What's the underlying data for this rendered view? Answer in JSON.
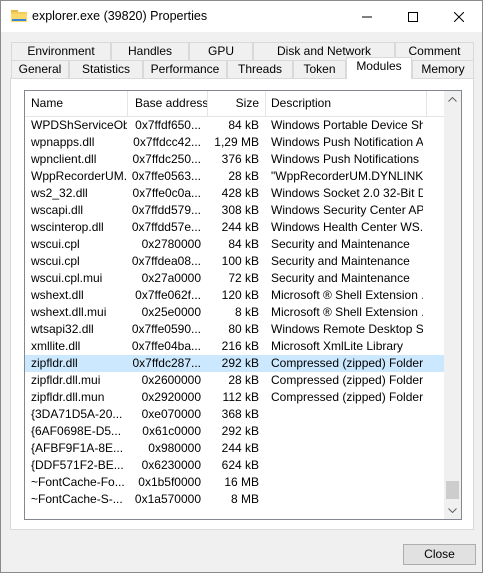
{
  "window": {
    "title": "explorer.exe (39820) Properties"
  },
  "tabs_back": [
    {
      "label": "Environment"
    },
    {
      "label": "Handles"
    },
    {
      "label": "GPU"
    },
    {
      "label": "Disk and Network"
    },
    {
      "label": "Comment"
    }
  ],
  "tabs_front": [
    {
      "label": "General"
    },
    {
      "label": "Statistics"
    },
    {
      "label": "Performance"
    },
    {
      "label": "Threads"
    },
    {
      "label": "Token"
    },
    {
      "label": "Modules"
    },
    {
      "label": "Memory"
    }
  ],
  "active_tab": "Modules",
  "columns": {
    "name": "Name",
    "base": "Base address",
    "size": "Size",
    "desc": "Description"
  },
  "rows": [
    {
      "name": "WPDShServiceObj.dll",
      "base": "0x7ffdf650...",
      "size": "84 kB",
      "desc": "Windows Portable Device Sh..."
    },
    {
      "name": "wpnapps.dll",
      "base": "0x7ffdcc42...",
      "size": "1,29 MB",
      "desc": "Windows Push Notification A..."
    },
    {
      "name": "wpnclient.dll",
      "base": "0x7ffdc250...",
      "size": "376 kB",
      "desc": "Windows Push Notifications ..."
    },
    {
      "name": "WppRecorderUM.dll",
      "base": "0x7ffe0563...",
      "size": "28 kB",
      "desc": "\"WppRecorderUM.DYNLINK\""
    },
    {
      "name": "ws2_32.dll",
      "base": "0x7ffe0c0a...",
      "size": "428 kB",
      "desc": "Windows Socket 2.0 32-Bit DLL"
    },
    {
      "name": "wscapi.dll",
      "base": "0x7ffdd579...",
      "size": "308 kB",
      "desc": "Windows Security Center API"
    },
    {
      "name": "wscinterop.dll",
      "base": "0x7ffdd57e...",
      "size": "244 kB",
      "desc": "Windows Health Center WS..."
    },
    {
      "name": "wscui.cpl",
      "base": "0x2780000",
      "size": "84 kB",
      "desc": "Security and Maintenance"
    },
    {
      "name": "wscui.cpl",
      "base": "0x7ffdea08...",
      "size": "100 kB",
      "desc": "Security and Maintenance"
    },
    {
      "name": "wscui.cpl.mui",
      "base": "0x27a0000",
      "size": "72 kB",
      "desc": "Security and Maintenance"
    },
    {
      "name": "wshext.dll",
      "base": "0x7ffe062f...",
      "size": "120 kB",
      "desc": "Microsoft ® Shell Extension ..."
    },
    {
      "name": "wshext.dll.mui",
      "base": "0x25e0000",
      "size": "8 kB",
      "desc": "Microsoft ® Shell Extension ..."
    },
    {
      "name": "wtsapi32.dll",
      "base": "0x7ffe0590...",
      "size": "80 kB",
      "desc": "Windows Remote Desktop S..."
    },
    {
      "name": "xmllite.dll",
      "base": "0x7ffe04ba...",
      "size": "216 kB",
      "desc": "Microsoft XmlLite Library"
    },
    {
      "name": "zipfldr.dll",
      "base": "0x7ffdc287...",
      "size": "292 kB",
      "desc": "Compressed (zipped) Folders",
      "selected": true
    },
    {
      "name": "zipfldr.dll.mui",
      "base": "0x2600000",
      "size": "28 kB",
      "desc": "Compressed (zipped) Folders"
    },
    {
      "name": "zipfldr.dll.mun",
      "base": "0x2920000",
      "size": "112 kB",
      "desc": "Compressed (zipped) Folders"
    },
    {
      "name": "{3DA71D5A-20...",
      "base": "0xe070000",
      "size": "368 kB",
      "desc": ""
    },
    {
      "name": "{6AF0698E-D5...",
      "base": "0x61c0000",
      "size": "292 kB",
      "desc": ""
    },
    {
      "name": "{AFBF9F1A-8E...",
      "base": "0x980000",
      "size": "244 kB",
      "desc": ""
    },
    {
      "name": "{DDF571F2-BE...",
      "base": "0x6230000",
      "size": "624 kB",
      "desc": ""
    },
    {
      "name": "~FontCache-Fo...",
      "base": "0x1b5f0000",
      "size": "16 MB",
      "desc": ""
    },
    {
      "name": "~FontCache-S-...",
      "base": "0x1a570000",
      "size": "8 MB",
      "desc": ""
    }
  ],
  "buttons": {
    "close": "Close"
  },
  "colors": {
    "selection": "#cce8ff",
    "panel": "#ffffff",
    "chrome": "#f0f0f0"
  }
}
